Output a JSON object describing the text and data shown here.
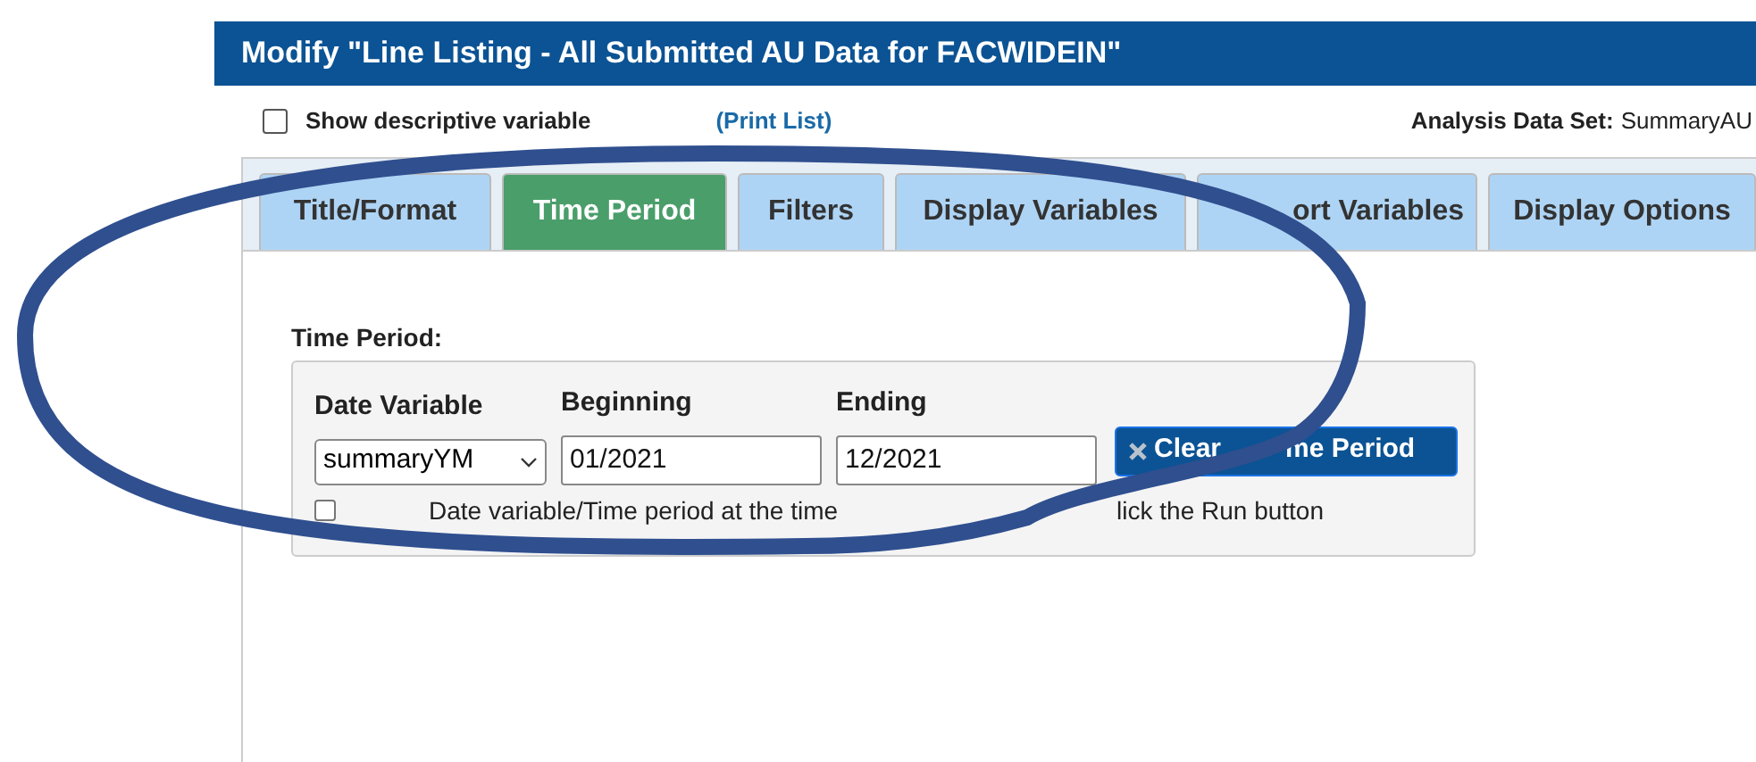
{
  "dialog": {
    "title": "Modify \"Line Listing - All Submitted AU Data for FACWIDEIN\""
  },
  "show_names": {
    "checked": false,
    "label": "Show descriptive variable",
    "link": "(Print List)"
  },
  "analysis_data_set": {
    "label": "Analysis Data Set:",
    "value": "SummaryAU"
  },
  "tabs": [
    {
      "label": "Title/Format",
      "selected": false
    },
    {
      "label": "Time Period",
      "selected": true
    },
    {
      "label": "Filters",
      "selected": false
    },
    {
      "label": "Display Variables",
      "selected": false
    },
    {
      "label": "ort Variables",
      "selected": false
    },
    {
      "label": "Display Options",
      "selected": false
    }
  ],
  "time_period": {
    "heading": "Time Period:",
    "fields": [
      {
        "kind": "select",
        "label": "Date Variable",
        "value": "summaryYM"
      },
      {
        "kind": "input",
        "label": "Beginning",
        "value": "01/2021"
      },
      {
        "kind": "input",
        "label": "Ending",
        "value": "12/2021"
      }
    ],
    "clear_button": {
      "label_start": "Clear",
      "label_end": "me Period"
    },
    "enter_later": {
      "checked": false,
      "text_start": "Date variable/Time period at the time",
      "text_end": "lick the Run button"
    }
  }
}
